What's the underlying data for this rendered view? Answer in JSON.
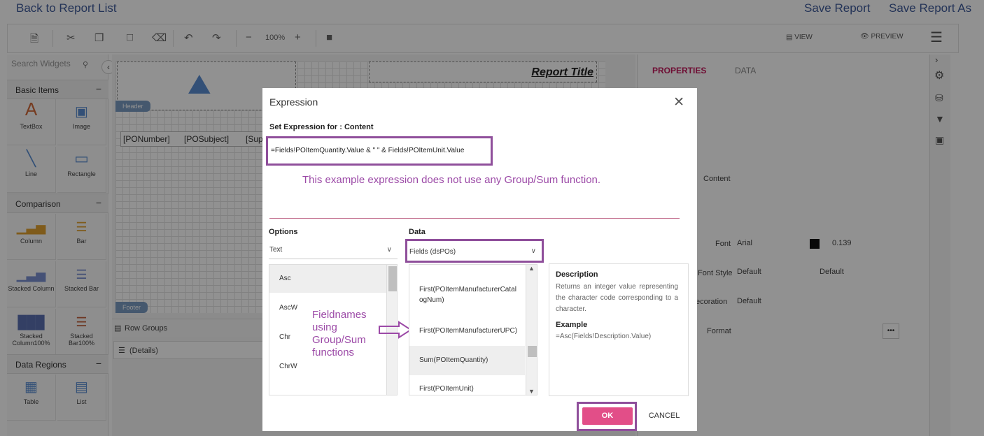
{
  "topbar": {
    "back_label": "Back to Report List",
    "save_label": "Save Report",
    "save_as_label": "Save Report As"
  },
  "toolbar": {
    "zoom": "100%",
    "view_label": "VIEW",
    "preview_label": "PREVIEW"
  },
  "widgets": {
    "search_placeholder": "Search Widgets",
    "sections": {
      "basic": "Basic Items",
      "comparison": "Comparison",
      "data_regions": "Data Regions"
    },
    "items": {
      "textbox": "TextBox",
      "image": "Image",
      "line": "Line",
      "rectangle": "Rectangle",
      "column": "Column",
      "bar": "Bar",
      "stacked_column": "Stacked Column",
      "stacked_bar": "Stacked Bar",
      "stacked_column100": "Stacked Column100%",
      "stacked_bar100": "Stacked Bar100%",
      "table": "Table",
      "list": "List"
    }
  },
  "designer": {
    "report_title": "Report Title",
    "header_tab": "Header",
    "footer_tab": "Footer",
    "fields": [
      "[PONumber]",
      "[POSubject]",
      "[Supp"
    ],
    "row_groups": "Row Groups",
    "details": "(Details)"
  },
  "properties": {
    "tab_properties": "PROPERTIES",
    "tab_data": "DATA",
    "content_label": "Content",
    "font_label": "Font",
    "font_value": "Arial",
    "font_size": "0.139",
    "font_style_label": "Font Style",
    "font_style_value1": "Default",
    "font_style_value2": "Default",
    "decoration_label": "ecoration",
    "decoration_value": "Default",
    "format_label": "Format",
    "format_btn": "•••"
  },
  "dialog": {
    "title": "Expression",
    "set_expression_label": "Set Expression for : Content",
    "expression": "=Fields!POItemQuantity.Value & \" \" & Fields!POItemUnit.Value",
    "note": "This example expression does not use any Group/Sum function.",
    "options_label": "Options",
    "options_selected": "Text",
    "data_label": "Data",
    "data_selected": "Fields (dsPOs)",
    "options_items": [
      "Asc",
      "AscW",
      "Chr",
      "ChrW"
    ],
    "data_items": [
      "First(POItemManufacturerCatal ogNum)",
      "First(POItemManufacturerUPC)",
      "Sum(POItemQuantity)",
      "First(POItemUnit)"
    ],
    "annotation": "Fieldnames using Group/Sum functions",
    "description_title": "Description",
    "description_text": "Returns an integer value representing the character code corresponding to a character.",
    "example_title": "Example",
    "example_text": "=Asc(Fields!Description.Value)",
    "ok_label": "OK",
    "cancel_label": "CANCEL"
  },
  "colors": {
    "accent_purple": "#8f4f9b",
    "ok_pink": "#e24e88",
    "link_blue": "#3e5a99"
  }
}
